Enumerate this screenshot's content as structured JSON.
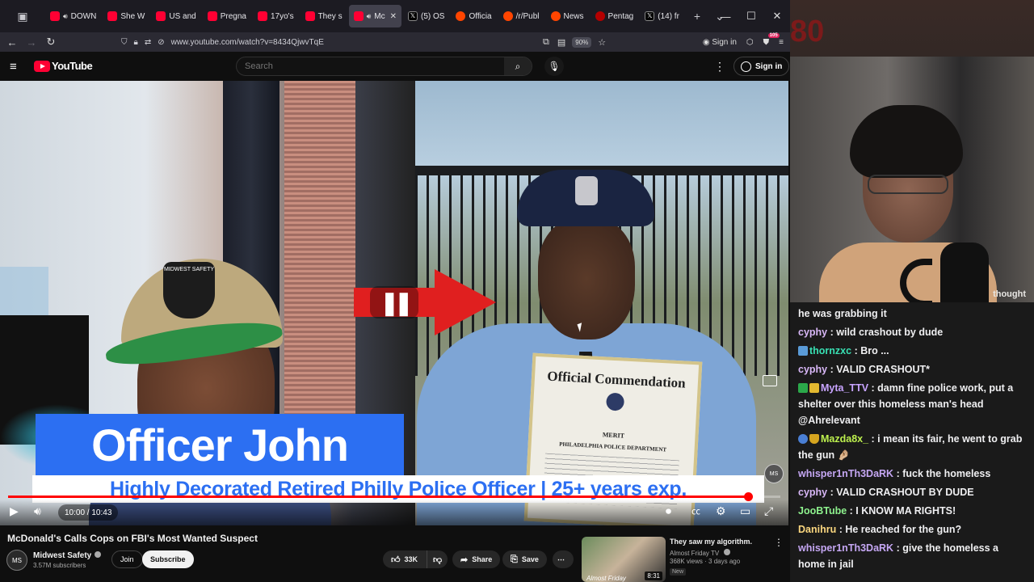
{
  "browser": {
    "tabs": [
      {
        "label": "DOWN",
        "icon": "youtube",
        "audio": true
      },
      {
        "label": "She W",
        "icon": "youtube"
      },
      {
        "label": "US and",
        "icon": "youtube"
      },
      {
        "label": "Pregna",
        "icon": "youtube"
      },
      {
        "label": "17yo's",
        "icon": "youtube"
      },
      {
        "label": "They s",
        "icon": "youtube"
      },
      {
        "label": "Mc",
        "icon": "youtube",
        "audio": true,
        "active": true
      },
      {
        "label": "(5) OS",
        "icon": "x"
      },
      {
        "label": "Officia",
        "icon": "reddit"
      },
      {
        "label": "/r/Publ",
        "icon": "reddit"
      },
      {
        "label": "News",
        "icon": "reddit"
      },
      {
        "label": "Pentag",
        "icon": "msnbc"
      },
      {
        "label": "(14) fr",
        "icon": "x"
      }
    ],
    "url": "www.youtube.com/watch?v=8434QjwvTqE",
    "zoom": "90%",
    "signin_label": "Sign in",
    "extension_badge": "105"
  },
  "youtube": {
    "logo_text": "YouTube",
    "search_placeholder": "Search",
    "signin_label": "Sign in"
  },
  "video": {
    "overlay_title": "Officer John",
    "overlay_subtitle": "Highly Decorated Retired Philly Police Officer | 25+ years exp.",
    "cap_logo_text": "MIDWEST SAFETY",
    "commendation_title": "Official Commendation",
    "commendation_merit": "MERIT",
    "commendation_dept": "PHILADELPHIA POLICE DEPARTMENT",
    "time": "10:00 / 10:43",
    "progress_fraction": 0.958
  },
  "below": {
    "title": "McDonald's Calls Cops on FBI's Most Wanted Suspect",
    "channel": "Midwest Safety",
    "subscribers": "3.57M subscribers",
    "join": "Join",
    "subscribe": "Subscribe",
    "likes": "33K",
    "share": "Share",
    "save": "Save"
  },
  "recommendation": {
    "title": "They saw my algorithm.",
    "channel": "Almost Friday TV",
    "meta": "368K views · 3 days ago",
    "badge": "New",
    "duration": "8:31",
    "thumb_text": "Almost Friday"
  },
  "webcam": {
    "overlay_text": "thought",
    "corner_text": "80"
  },
  "chat": [
    {
      "user": "",
      "text": "he was grabbing it",
      "color": "none"
    },
    {
      "user": "cyphy",
      "text": ": wild crashout by dude",
      "color": "cyphy"
    },
    {
      "user": "thornzxc",
      "text": ": Bro ...",
      "color": "thorn",
      "badge": "tv"
    },
    {
      "user": "cyphy",
      "text": ": VALID CRASHOUT*",
      "color": "cyphy"
    },
    {
      "user": "Myta_TTV",
      "text": ": damn fine police work, put a shelter over this homeless man's head @Ahrelevant",
      "color": "myta",
      "badge": "check"
    },
    {
      "user": "Mazda8x_",
      "text": ": i mean its fair, he went to grab the gun 🤌🏼",
      "color": "mazda",
      "badge": "user"
    },
    {
      "user": "whisper1nTh3DaRK",
      "text": ": fuck the homeless",
      "color": "whisper"
    },
    {
      "user": "cyphy",
      "text": ": VALID CRASHOUT BY DUDE",
      "color": "cyphy"
    },
    {
      "user": "JooBTube",
      "text": ": I KNOW MA RIGHTS!",
      "color": "joob"
    },
    {
      "user": "Danihru",
      "text": ": He reached for the gun?",
      "color": "danihru"
    },
    {
      "user": "whisper1nTh3DaRK",
      "text": ": give the homeless a home in jail",
      "color": "whisper"
    }
  ]
}
